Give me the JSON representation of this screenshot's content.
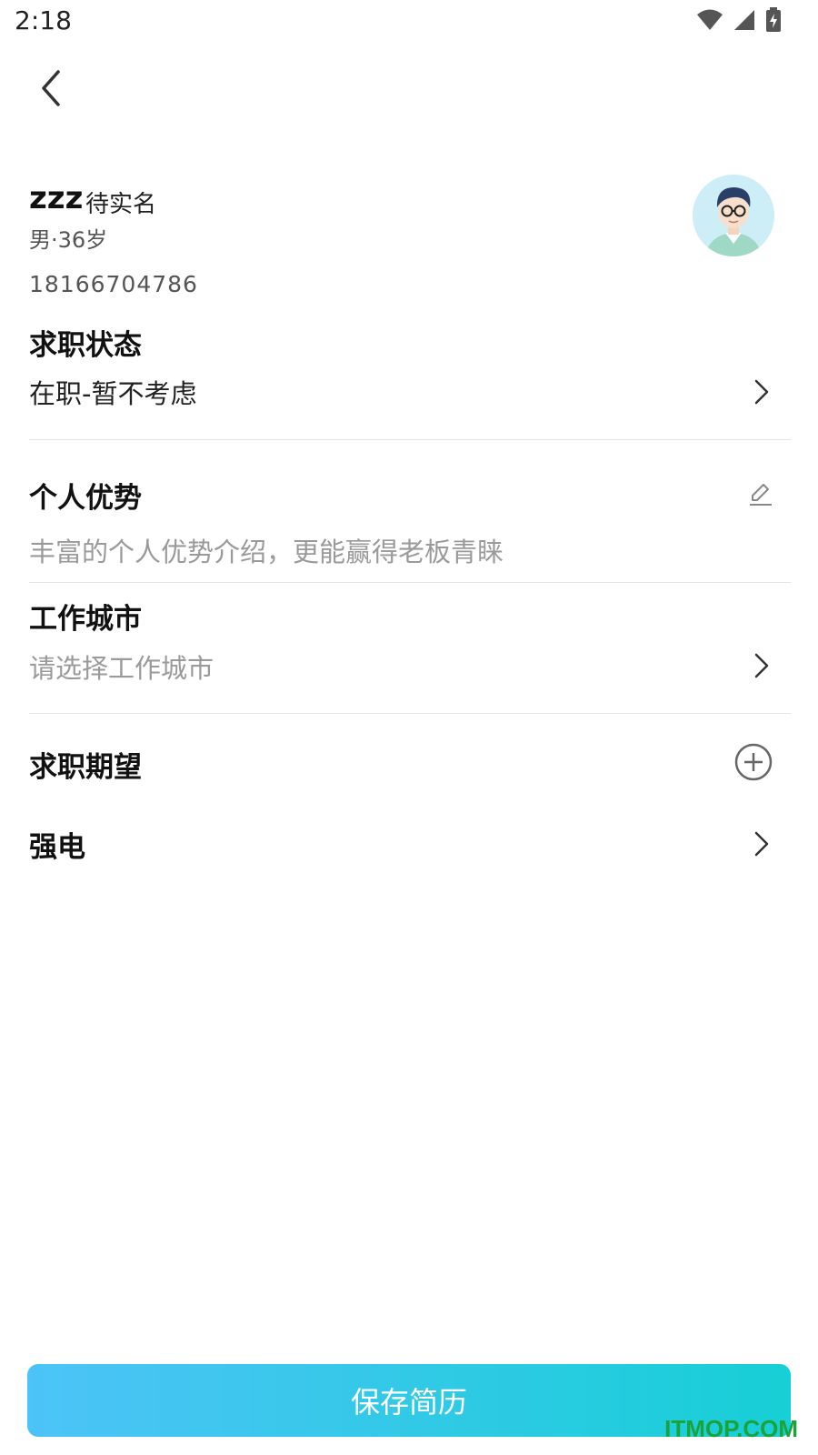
{
  "status_bar": {
    "time": "2:18"
  },
  "profile": {
    "name": "zzz",
    "verify_status": "待实名",
    "gender_age": "男·36岁",
    "phone": "18166704786"
  },
  "job_status": {
    "title": "求职状态",
    "value": "在职-暂不考虑"
  },
  "advantage": {
    "title": "个人优势",
    "placeholder": "丰富的个人优势介绍，更能赢得老板青睐"
  },
  "work_city": {
    "title": "工作城市",
    "placeholder": "请选择工作城市"
  },
  "expectation": {
    "title": "求职期望",
    "items": [
      {
        "label": "强电"
      }
    ]
  },
  "save_button": {
    "label": "保存简历"
  },
  "watermark": "ITMOP.COM",
  "colors": {
    "button_gradient_start": "#4dc3f7",
    "button_gradient_end": "#17cfd6"
  }
}
